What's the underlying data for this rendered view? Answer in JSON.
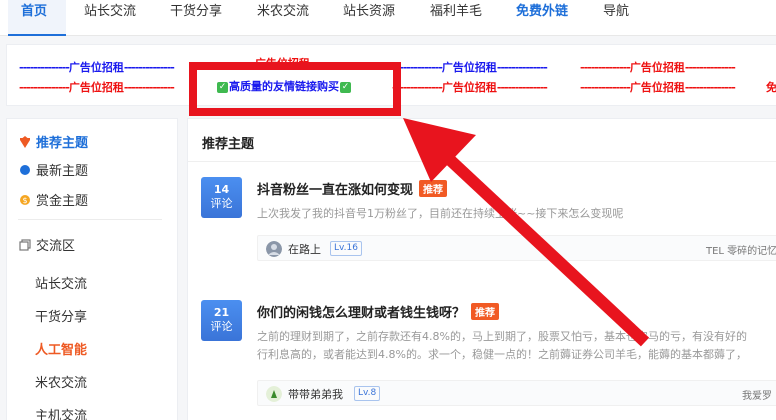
{
  "nav": {
    "items": [
      "首页",
      "站长交流",
      "干货分享",
      "米农交流",
      "站长资源",
      "福利羊毛",
      "免费外链",
      "导航"
    ]
  },
  "ads": {
    "dashes": "--------------",
    "label": "广告位招租",
    "label_partial": "广告位招租",
    "highlight": "高质量的友情链接购买",
    "edge_char": "免"
  },
  "sidebar": {
    "recommended": "推荐主题",
    "latest": "最新主题",
    "bounty": "赏金主题",
    "exchange": "交流区",
    "sub": [
      "站长交流",
      "干货分享",
      "人工智能",
      "米农交流",
      "主机交流"
    ]
  },
  "main": {
    "title": "推荐主题",
    "topics": [
      {
        "count": "14",
        "count_label": "评论",
        "title": "抖音粉丝一直在涨如何变现",
        "tag": "推荐",
        "excerpt": "上次我发了我的抖音号1万粉丝了，目前还在持续上涨~~接下来怎么变现呢",
        "author": "在路上",
        "level": "Lv.16",
        "last_reply": "TEL 零碎的记忆"
      },
      {
        "count": "21",
        "count_label": "评论",
        "title": "你们的闲钱怎么理财或者钱生钱呀？",
        "tag": "推荐",
        "excerpt_1": "之前的理财到期了，之前存款还有4.8%的，马上到期了，股票又怕亏，基本也它马的亏，有没有好的",
        "excerpt_2": "行利息高的，或者能达到4.8%的。求一个，稳健一点的！之前薅证券公司羊毛，能薅的基本都薅了，",
        "author": "带带弟弟我",
        "level": "Lv.8",
        "last_reply": "我爱罗"
      }
    ]
  },
  "colors": {
    "accent": "#1e6fd9",
    "ad_red": "#ee1111",
    "ad_blue": "#1a1aee",
    "tag_orange": "#f15a24",
    "annotation_red": "#e8141e"
  }
}
